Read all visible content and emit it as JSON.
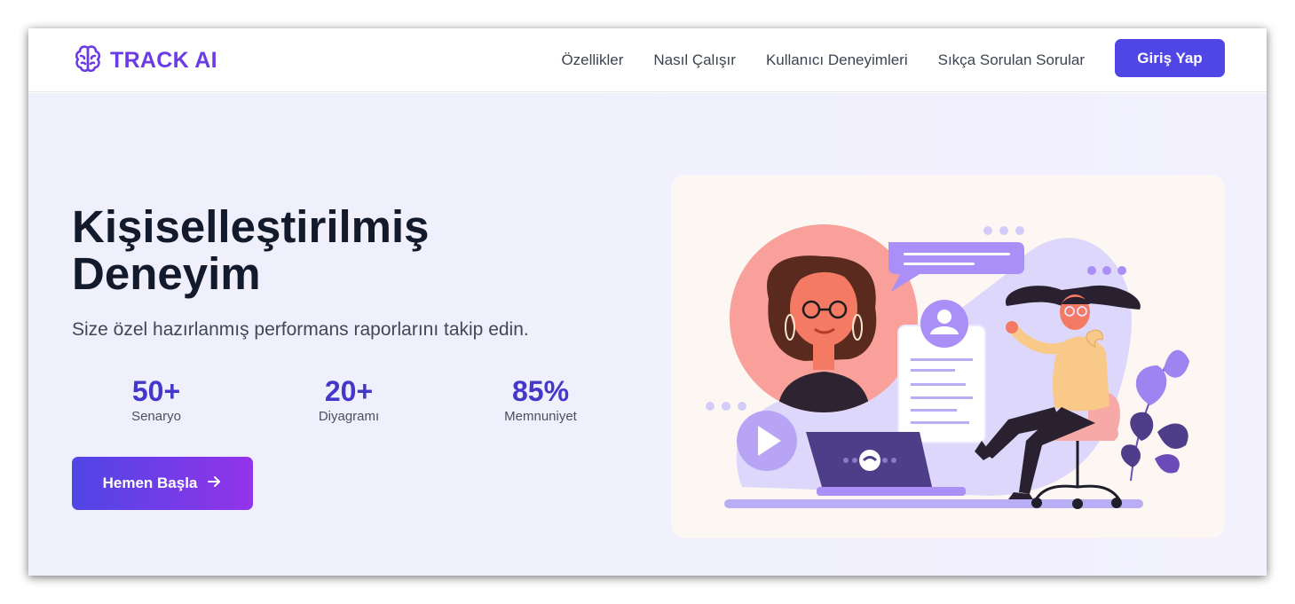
{
  "brand": {
    "name": "TRACK AI",
    "logo_icon": "brain-icon",
    "color": "#6b3ce6"
  },
  "nav": {
    "links": [
      "Özellikler",
      "Nasıl Çalışır",
      "Kullanıcı Deneyimleri",
      "Sıkça Sorulan Sorular"
    ],
    "login_label": "Giriş Yap"
  },
  "hero": {
    "title": "Kişiselleştirilmiş Deneyim",
    "subtitle": "Size özel hazırlanmış performans raporlarını takip edin.",
    "stats": [
      {
        "value": "50+",
        "label": "Senaryo"
      },
      {
        "value": "20+",
        "label": "Diyagramı"
      },
      {
        "value": "85%",
        "label": "Memnuniyet"
      }
    ],
    "cta_label": "Hemen Başla",
    "cta_icon": "arrow-right-icon"
  },
  "illustration": {
    "name": "video-call-illustration",
    "colors": {
      "accent": "#a98ff7",
      "peach": "#f9a09a",
      "lavender": "#d7d2fa",
      "dark": "#4e3d88"
    }
  },
  "theme": {
    "primary": "#4f46e5",
    "gradient_end": "#9333ea",
    "stat_color": "#4338ca"
  }
}
